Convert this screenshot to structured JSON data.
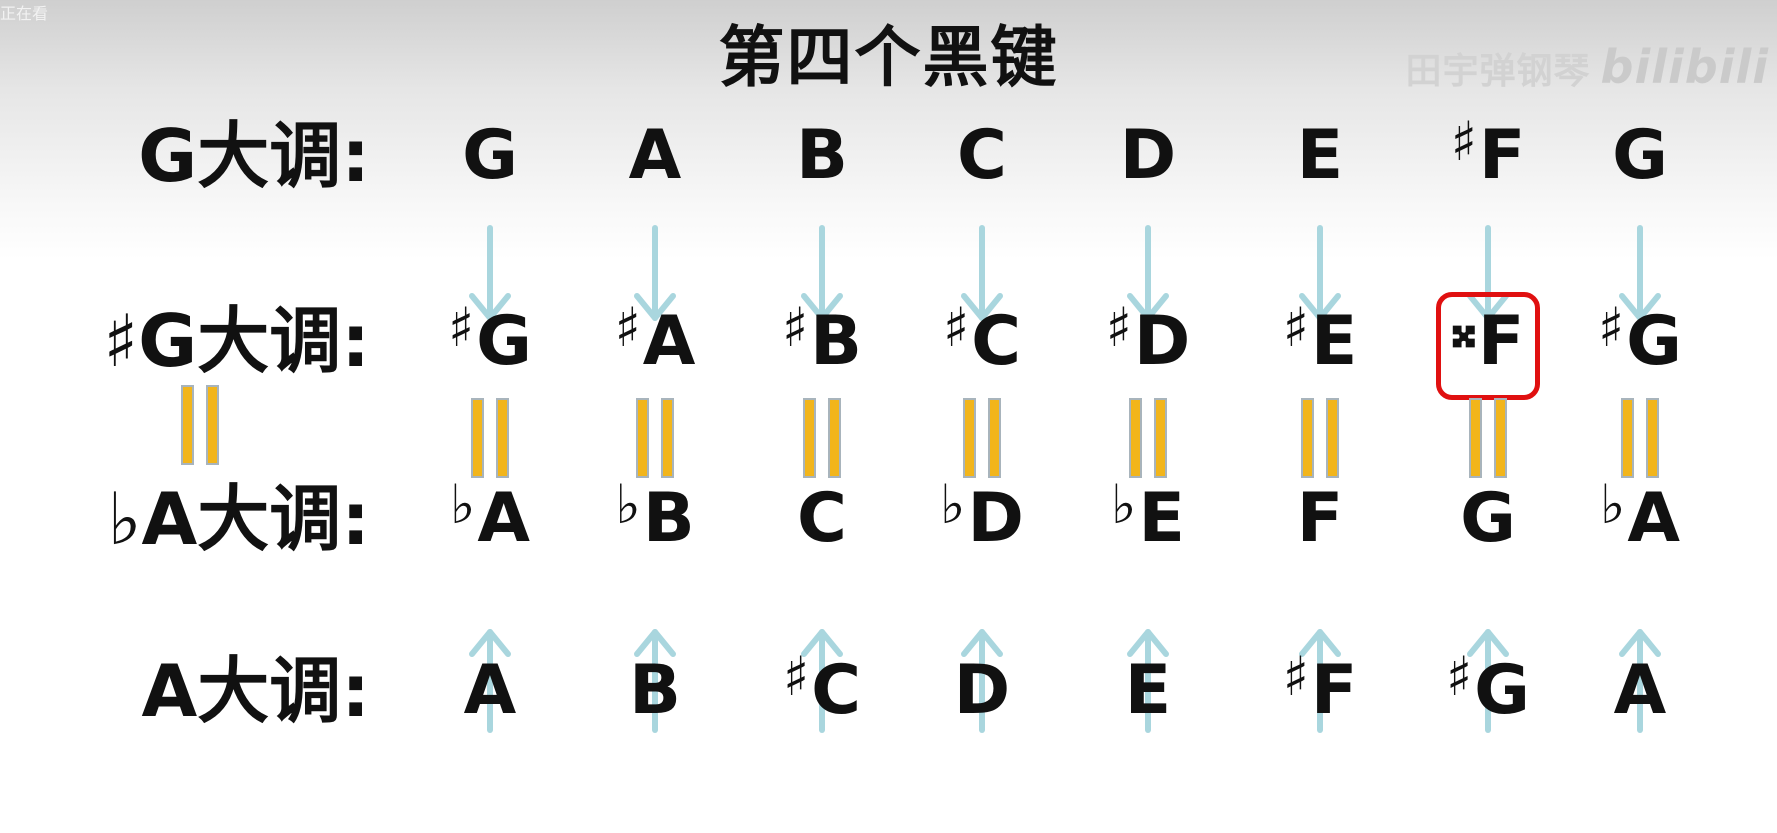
{
  "overlay": {
    "status_text": "正在看"
  },
  "title": "第四个黑键",
  "watermark": {
    "text": "田宇弹钢琴",
    "brand": "bilibili"
  },
  "rows": {
    "g_major": {
      "label": "G大调:",
      "notes": [
        "G",
        "A",
        "B",
        "C",
        "D",
        "E",
        "♯F",
        "G"
      ]
    },
    "gsharp_major": {
      "label": "♯G大调:",
      "notes": [
        "♯G",
        "♯A",
        "♯B",
        "♯C",
        "♯D",
        "♯E",
        "𝄪F",
        "♯G"
      ]
    },
    "aflat_major": {
      "label": "♭A大调:",
      "notes": [
        "♭A",
        "♭B",
        "C",
        "♭D",
        "♭E",
        "F",
        "G",
        "♭A"
      ]
    },
    "a_major": {
      "label": "A大调:",
      "notes": [
        "A",
        "B",
        "♯C",
        "D",
        "E",
        "♯F",
        "♯G",
        "A"
      ]
    }
  },
  "highlight": {
    "row": "gsharp_major",
    "index": 6,
    "color": "#e01010"
  },
  "colors": {
    "arrow": "#a9d6de",
    "equals_fill": "#f2b51b",
    "text": "#111111"
  },
  "icons": {
    "arrow_down": "arrow-down-icon",
    "arrow_up": "arrow-up-icon",
    "equals": "equals-sign-icon"
  }
}
